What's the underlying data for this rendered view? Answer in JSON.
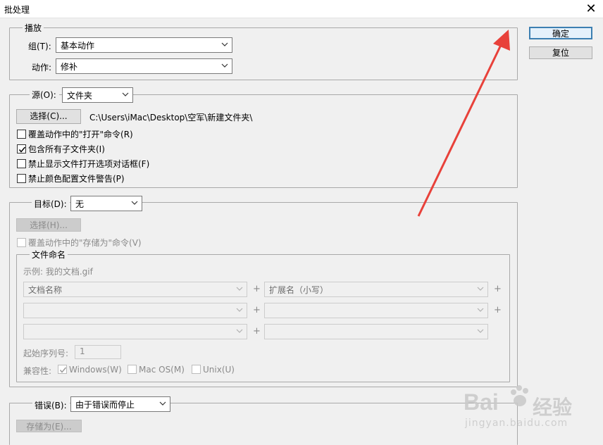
{
  "window": {
    "title": "批处理",
    "close_glyph": "✕"
  },
  "buttons": {
    "ok": "确定",
    "reset": "复位"
  },
  "play": {
    "legend": "播放",
    "group_label": "组(T):",
    "group_value": "基本动作",
    "action_label": "动作:",
    "action_value": "修补"
  },
  "source": {
    "label": "源(O):",
    "value": "文件夹",
    "choose_button": "选择(C)...",
    "path": "C:\\Users\\iMac\\Desktop\\空军\\新建文件夹\\",
    "options": [
      {
        "label": "覆盖动作中的\"打开\"命令(R)",
        "checked": false
      },
      {
        "label": "包含所有子文件夹(I)",
        "checked": true
      },
      {
        "label": "禁止显示文件打开选项对话框(F)",
        "checked": false
      },
      {
        "label": "禁止颜色配置文件警告(P)",
        "checked": false
      }
    ]
  },
  "target": {
    "label": "目标(D):",
    "value": "无",
    "choose_button": "选择(H)...",
    "override_label": "覆盖动作中的\"存储为\"命令(V)",
    "naming": {
      "legend": "文件命名",
      "example": "示例: 我的文档.gif",
      "row1": {
        "left": "文档名称",
        "right": "扩展名（小写）"
      },
      "row2": {
        "left": "",
        "right": ""
      },
      "row3": {
        "left": "",
        "right": ""
      },
      "plus": "+",
      "start_serial_label": "起始序列号:",
      "start_serial_value": "1",
      "compat_label": "兼容性:",
      "compat": [
        {
          "label": "Windows(W)",
          "checked": true
        },
        {
          "label": "Mac OS(M)",
          "checked": false
        },
        {
          "label": "Unix(U)",
          "checked": false
        }
      ]
    }
  },
  "errors": {
    "label": "错误(B):",
    "value": "由于错误而停止",
    "save_button": "存储为(E)..."
  },
  "watermark": {
    "brand": "Bai",
    "brand2": "经验",
    "url": "jingyan.baidu.com"
  },
  "annotation": {
    "color": "#e8413a"
  }
}
